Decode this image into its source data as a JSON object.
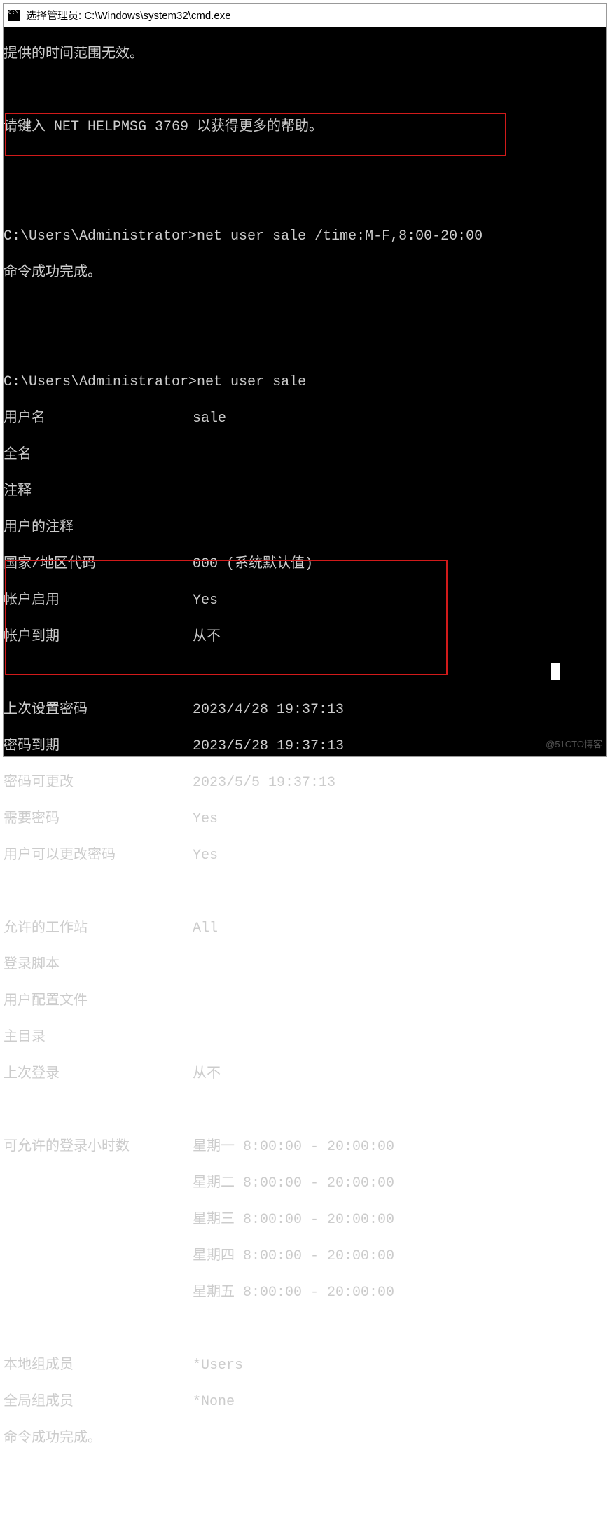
{
  "titlebar": {
    "text": "选择管理员: C:\\Windows\\system32\\cmd.exe",
    "icon": "cmd-icon"
  },
  "lines": {
    "err": "提供的时间范围无效。",
    "help": "请键入 NET HELPMSG 3769 以获得更多的帮助。",
    "prompt1": "C:\\Users\\Administrator>",
    "cmd1": "net user sale /time:M-F,8:00-20:00",
    "ok1": "命令成功完成。",
    "prompt2": "C:\\Users\\Administrator>",
    "cmd2": "net user sale",
    "ok2": "命令成功完成。"
  },
  "userinfo": [
    {
      "k": "用户名",
      "v": "sale"
    },
    {
      "k": "全名",
      "v": ""
    },
    {
      "k": "注释",
      "v": ""
    },
    {
      "k": "用户的注释",
      "v": ""
    },
    {
      "k": "国家/地区代码",
      "v": "000 (系统默认值)"
    },
    {
      "k": "帐户启用",
      "v": "Yes"
    },
    {
      "k": "帐户到期",
      "v": "从不"
    }
  ],
  "pwdinfo": [
    {
      "k": "上次设置密码",
      "v": "2023/4/28 19:37:13"
    },
    {
      "k": "密码到期",
      "v": "2023/5/28 19:37:13"
    },
    {
      "k": "密码可更改",
      "v": "2023/5/5 19:37:13"
    },
    {
      "k": "需要密码",
      "v": "Yes"
    },
    {
      "k": "用户可以更改密码",
      "v": "Yes"
    }
  ],
  "logininfo": [
    {
      "k": "允许的工作站",
      "v": "All"
    },
    {
      "k": "登录脚本",
      "v": ""
    },
    {
      "k": "用户配置文件",
      "v": ""
    },
    {
      "k": "主目录",
      "v": ""
    },
    {
      "k": "上次登录",
      "v": "从不"
    }
  ],
  "hours_label": "可允许的登录小时数",
  "hours": [
    "星期一 8:00:00 - 20:00:00",
    "星期二 8:00:00 - 20:00:00",
    "星期三 8:00:00 - 20:00:00",
    "星期四 8:00:00 - 20:00:00",
    "星期五 8:00:00 - 20:00:00"
  ],
  "groups": [
    {
      "k": "本地组成员",
      "v": "*Users"
    },
    {
      "k": "全局组成员",
      "v": "*None"
    }
  ],
  "watermark": "@51CTO博客"
}
